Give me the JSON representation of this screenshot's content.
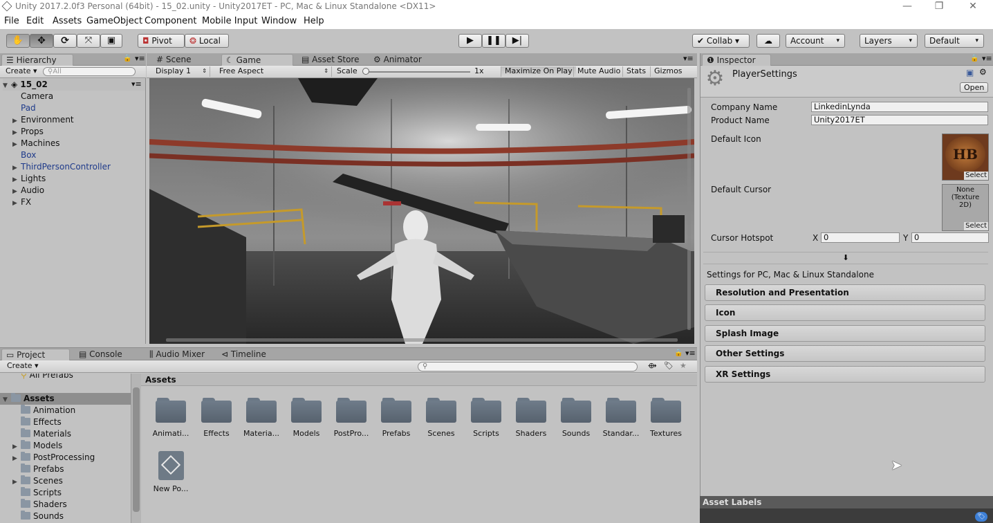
{
  "window": {
    "title": "Unity 2017.2.0f3 Personal (64bit) - 15_02.unity - Unity2017ET - PC, Mac & Linux Standalone <DX11>",
    "minimize": "—",
    "restore": "❐",
    "close": "✕"
  },
  "menu": [
    "File",
    "Edit",
    "Assets",
    "GameObject",
    "Component",
    "Mobile Input",
    "Window",
    "Help"
  ],
  "toolbar": {
    "pivot": "Pivot",
    "local": "Local",
    "collab": "Collab ▾",
    "account": "Account",
    "layers": "Layers",
    "layout": "Default"
  },
  "hierarchy": {
    "tab": "Hierarchy",
    "create": "Create ▾",
    "search_placeholder": "All",
    "scene": "15_02",
    "items": [
      {
        "label": "Camera",
        "expandable": false,
        "prefab": false
      },
      {
        "label": "Pad",
        "expandable": false,
        "prefab": true
      },
      {
        "label": "Environment",
        "expandable": true,
        "prefab": false
      },
      {
        "label": "Props",
        "expandable": true,
        "prefab": false
      },
      {
        "label": "Machines",
        "expandable": true,
        "prefab": false
      },
      {
        "label": "Box",
        "expandable": false,
        "prefab": true
      },
      {
        "label": "ThirdPersonController",
        "expandable": true,
        "prefab": true
      },
      {
        "label": "Lights",
        "expandable": true,
        "prefab": false
      },
      {
        "label": "Audio",
        "expandable": true,
        "prefab": false
      },
      {
        "label": "FX",
        "expandable": true,
        "prefab": false
      }
    ]
  },
  "view_tabs": {
    "scene": "Scene",
    "game": "Game",
    "asset_store": "Asset Store",
    "animator": "Animator"
  },
  "game_bar": {
    "display": "Display 1",
    "aspect": "Free Aspect",
    "scale_label": "Scale",
    "scale_value": "1x",
    "maximize": "Maximize On Play",
    "mute": "Mute Audio",
    "stats": "Stats",
    "gizmos": "Gizmos"
  },
  "bottom_tabs": {
    "project": "Project",
    "console": "Console",
    "audio_mixer": "Audio Mixer",
    "timeline": "Timeline"
  },
  "project": {
    "create": "Create ▾",
    "all_prefabs": "All Prefabs",
    "tree_root": "Assets",
    "tree": [
      {
        "label": "Animation",
        "expandable": false
      },
      {
        "label": "Effects",
        "expandable": false
      },
      {
        "label": "Materials",
        "expandable": false
      },
      {
        "label": "Models",
        "expandable": true
      },
      {
        "label": "PostProcessing",
        "expandable": true
      },
      {
        "label": "Prefabs",
        "expandable": false
      },
      {
        "label": "Scenes",
        "expandable": true
      },
      {
        "label": "Scripts",
        "expandable": false
      },
      {
        "label": "Shaders",
        "expandable": false
      },
      {
        "label": "Sounds",
        "expandable": false
      }
    ],
    "breadcrumb": "Assets",
    "folders": [
      "Animati...",
      "Effects",
      "Materia...",
      "Models",
      "PostPro...",
      "Prefabs",
      "Scenes",
      "Scripts",
      "Shaders",
      "Sounds",
      "Standar...",
      "Textures"
    ],
    "extra_asset": "New Po..."
  },
  "inspector": {
    "tab": "Inspector",
    "title": "PlayerSettings",
    "open": "Open",
    "company_label": "Company Name",
    "company_value": "LinkedinLynda",
    "product_label": "Product Name",
    "product_value": "Unity2017ET",
    "default_icon_label": "Default Icon",
    "icon_text": "HB",
    "select": "Select",
    "default_cursor_label": "Default Cursor",
    "cursor_none": "None\n(Texture\n2D)",
    "hotspot_label": "Cursor Hotspot",
    "hotspot_x_label": "X",
    "hotspot_x": "0",
    "hotspot_y_label": "Y",
    "hotspot_y": "0",
    "platform_label": "Settings for PC, Mac & Linux Standalone",
    "sections": [
      "Resolution and Presentation",
      "Icon",
      "Splash Image",
      "Other Settings",
      "XR Settings"
    ],
    "asset_labels": "Asset Labels"
  }
}
